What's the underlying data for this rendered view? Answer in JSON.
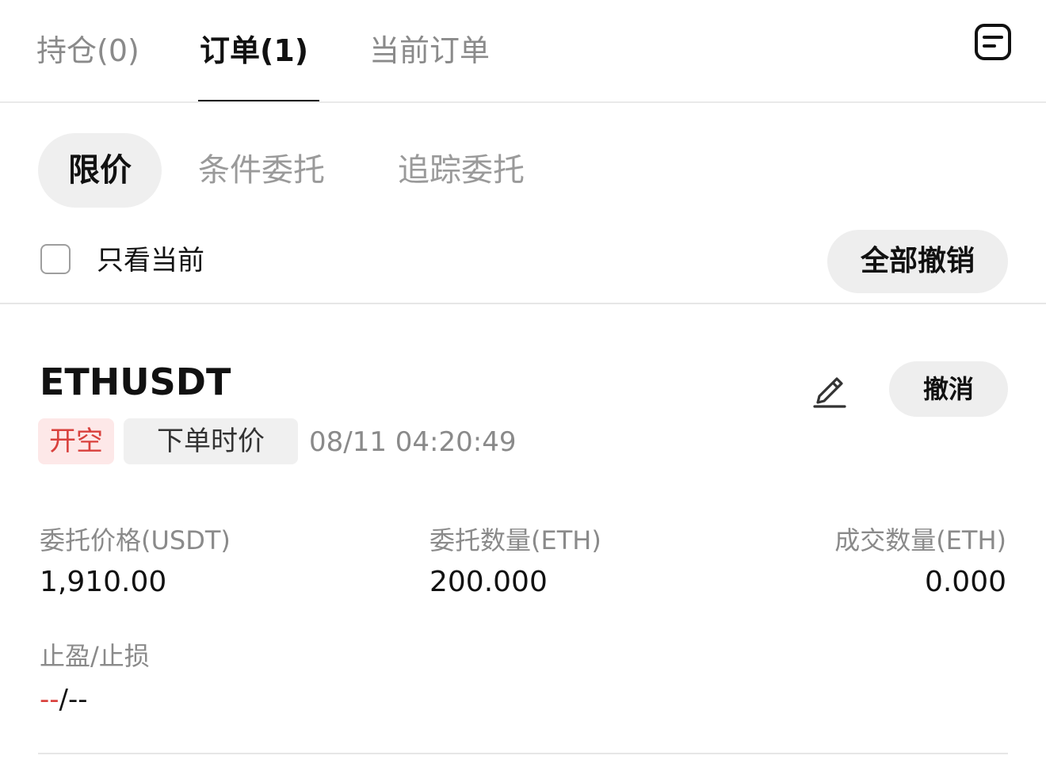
{
  "header": {
    "tabs": [
      {
        "label": "持仓(0)",
        "active": false
      },
      {
        "label": "订单(1)",
        "active": true
      },
      {
        "label": "当前订单",
        "active": false
      }
    ],
    "right_icon": "document-list-icon"
  },
  "order_types": {
    "tabs": [
      {
        "label": "限价",
        "active": true
      },
      {
        "label": "条件委托",
        "active": false
      },
      {
        "label": "追踪委托",
        "active": false
      }
    ]
  },
  "filter": {
    "checkbox_label": "只看当前",
    "checked": false,
    "cancel_all_label": "全部撤销"
  },
  "order": {
    "symbol": "ETHUSDT",
    "side_tag": "开空",
    "type_tag": "下单时价",
    "timestamp": "08/11 04:20:49",
    "edit_icon": "edit-pencil-icon",
    "cancel_label": "撤消",
    "fields": [
      {
        "label": "委托价格(USDT)",
        "value": "1,910.00"
      },
      {
        "label": "委托数量(ETH)",
        "value": "200.000"
      },
      {
        "label": "成交数量(ETH)",
        "value": "0.000"
      }
    ],
    "tp_sl": {
      "label": "止盈/止损",
      "value_part1": "--",
      "value_sep": "/",
      "value_part2": "--"
    }
  },
  "colors": {
    "accent_red": "#d9413d",
    "tag_red_bg": "#fde8e8",
    "muted_text": "#8a8a8a",
    "pill_bg": "#eeeeee"
  }
}
